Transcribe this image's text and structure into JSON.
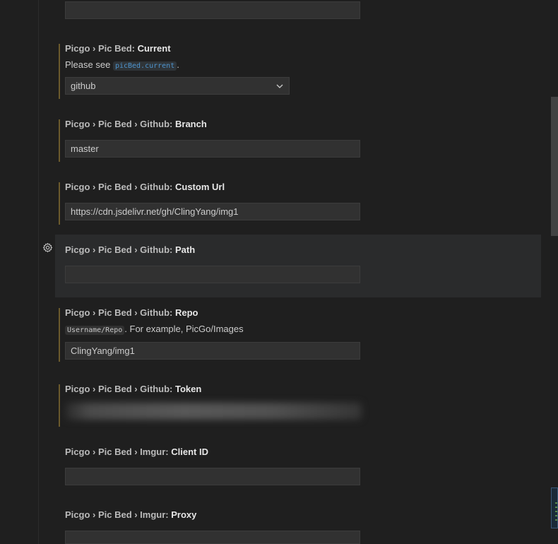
{
  "settings": [
    {
      "id": "top-partial",
      "value": ""
    },
    {
      "id": "pic-bed-current",
      "crumbs": "Picgo › Pic Bed: ",
      "key": "Current",
      "desc_prefix": "Please see ",
      "desc_code": "picBed.current",
      "desc_suffix": ".",
      "value": "github"
    },
    {
      "id": "github-branch",
      "crumbs": "Picgo › Pic Bed › Github: ",
      "key": "Branch",
      "value": "master"
    },
    {
      "id": "github-custom-url",
      "crumbs": "Picgo › Pic Bed › Github: ",
      "key": "Custom Url",
      "value": "https://cdn.jsdelivr.net/gh/ClingYang/img1"
    },
    {
      "id": "github-path",
      "crumbs": "Picgo › Pic Bed › Github: ",
      "key": "Path",
      "value": ""
    },
    {
      "id": "github-repo",
      "crumbs": "Picgo › Pic Bed › Github: ",
      "key": "Repo",
      "desc_code": "Username/Repo",
      "desc_suffix": ". For example, PicGo/Images",
      "value": "ClingYang/img1"
    },
    {
      "id": "github-token",
      "crumbs": "Picgo › Pic Bed › Github: ",
      "key": "Token",
      "value": ""
    },
    {
      "id": "imgur-client-id",
      "crumbs": "Picgo › Pic Bed › Imgur: ",
      "key": "Client ID",
      "value": ""
    },
    {
      "id": "imgur-proxy",
      "crumbs": "Picgo › Pic Bed › Imgur: ",
      "key": "Proxy",
      "value": ""
    }
  ],
  "icons": {
    "gear": "gear-icon",
    "chevron": "chevron-down-icon"
  },
  "colors": {
    "background": "#1f1f1f",
    "modified_indicator": "#6b5a2c",
    "link_code": "#4e94ce"
  }
}
